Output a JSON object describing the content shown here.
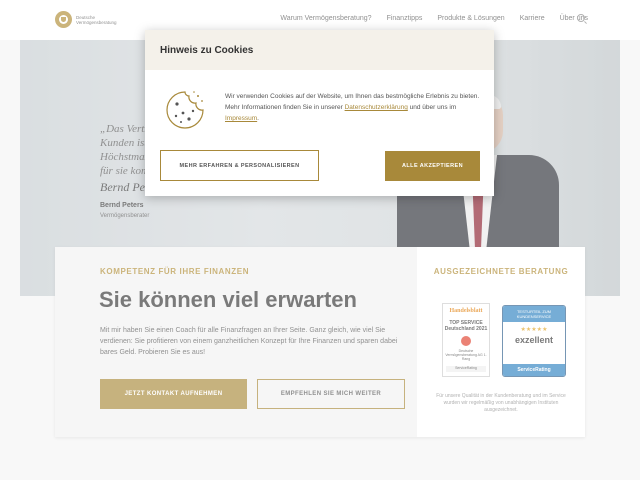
{
  "header": {
    "logo_line1": "Deutsche",
    "logo_line2": "Vermögensberatung",
    "nav": [
      "Warum Vermögensberatung?",
      "Finanztipps",
      "Produkte & Lösungen",
      "Karriere",
      "Über uns"
    ]
  },
  "hero": {
    "quote": "„Das Vertrauen meiner Kunden ist für mich Höchstmaß: Ich setze mich für sie kompetent ein.“",
    "signature": "Bernd Peters",
    "name": "Bernd Peters",
    "role": "Vermögensberater"
  },
  "card": {
    "eyebrow": "KOMPETENZ FÜR IHRE FINANZEN",
    "headline": "Sie können viel erwarten",
    "body": "Mit mir haben Sie einen Coach für alle Finanzfragen an Ihrer Seite. Ganz gleich, wie viel Sie verdienen: Sie profitieren von einem ganzheitlichen Konzept für Ihre Finanzen und sparen dabei bares Geld. Probieren Sie es aus!",
    "primary_button": "JETZT KONTAKT AUFNEHMEN",
    "secondary_button": "EMPFEHLEN SIE MICH WEITER"
  },
  "side": {
    "title": "AUSGEZEICHNETE BERATUNG",
    "award1": {
      "brand": "Handelsblatt",
      "title": "TOP SERVICE Deutschland 2021",
      "detail": "Deutsche Vermögensberatung AG 1. Rang",
      "foot": "ServiceRating"
    },
    "award2": {
      "head": "TESTURTEIL ZUM KUNDENSERVICE",
      "stars": "★★★★★",
      "rating": "exzellent",
      "foot": "ServiceRating"
    },
    "note": "Für unsere Qualität in der Kundenberatung und im Service wurden wir regelmäßig von unabhängigen Instituten ausgezeichnet."
  },
  "cookie": {
    "title": "Hinweis zu Cookies",
    "text_before": "Wir verwenden Cookies auf der Website, um Ihnen das bestmögliche Erlebnis zu bieten. Mehr Informationen finden Sie in unserer ",
    "privacy_link": "Datenschutzerklärung",
    "text_middle": " und über uns im ",
    "imprint_link": "Impressum",
    "text_after": ".",
    "secondary_button": "MEHR ERFAHREN & PERSONALISIEREN",
    "primary_button": "ALLE AKZEPTIEREN"
  },
  "colors": {
    "accent": "#a8893a",
    "modal_header": "#f4f1ea"
  }
}
